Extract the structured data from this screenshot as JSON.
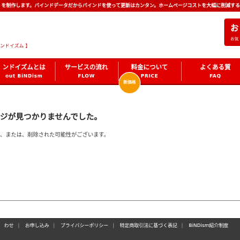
{
  "topbar": {
    "text": "を制作します。バインドデータだからバインドを使って更新はカンタン。ホームページコストを大幅に削減する"
  },
  "breadcrumb": "ンドイズム 】",
  "cta": {
    "big": "お",
    "small": "お気"
  },
  "nav": {
    "items": [
      {
        "jp": "ンドイズムとは",
        "en": "out BiNDism"
      },
      {
        "jp": "サービスの流れ",
        "en": "FLOW"
      },
      {
        "jp": "料金について",
        "en": "PRICE"
      },
      {
        "jp": "よくある質",
        "en": "FAQ"
      }
    ],
    "badge": "新価格"
  },
  "content": {
    "title": "ジが見つかりませんでした。",
    "message": "、または、削除された可能性がございます。"
  },
  "footer": {
    "links": [
      "わせ",
      "お申し込み",
      "プライバシーポリシー",
      "特定商取引法に基づく表記",
      "BiNDism紹介制度"
    ]
  },
  "colors": {
    "brand_red": "#e00000",
    "footer_bg": "#3a3a3a",
    "badge": "#f59a00"
  }
}
